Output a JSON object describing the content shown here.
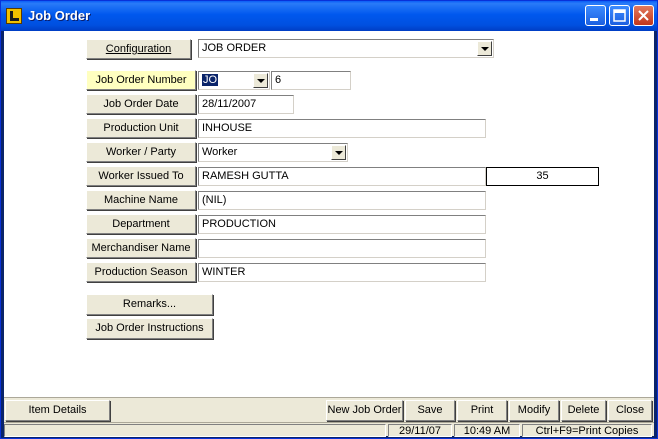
{
  "window": {
    "title": "Job Order",
    "accent": "#0058ee"
  },
  "form": {
    "configuration": {
      "label": "Configuration",
      "value": "JOB ORDER"
    },
    "job_order_number": {
      "label": "Job Order Number",
      "prefix": "JO",
      "number": "6"
    },
    "job_order_date": {
      "label": "Job Order Date",
      "value": "28/11/2007"
    },
    "production_unit": {
      "label": "Production Unit",
      "value": "INHOUSE"
    },
    "worker_party": {
      "label": "Worker / Party",
      "value": "Worker"
    },
    "worker_issued_to": {
      "label": "Worker Issued To",
      "value": "RAMESH GUTTA",
      "code": "35"
    },
    "machine_name": {
      "label": "Machine Name",
      "value": "(NIL)"
    },
    "department": {
      "label": "Department",
      "value": "PRODUCTION"
    },
    "merchandiser_name": {
      "label": "Merchandiser Name",
      "value": ""
    },
    "production_season": {
      "label": "Production Season",
      "value": "WINTER"
    },
    "remarks_button": "Remarks...",
    "instructions_button": "Job Order Instructions"
  },
  "toolbar": {
    "item_details": "Item Details",
    "new_job_order": "New Job Order",
    "save": "Save",
    "print": "Print",
    "modify": "Modify",
    "delete": "Delete",
    "close": "Close"
  },
  "status": {
    "date": "29/11/07",
    "time": "10:49 AM",
    "hint": "Ctrl+F9=Print Copies"
  },
  "icons": {
    "app": "job-order-app-icon",
    "minimize": "minimize-icon",
    "maximize": "maximize-icon",
    "close": "close-icon"
  }
}
